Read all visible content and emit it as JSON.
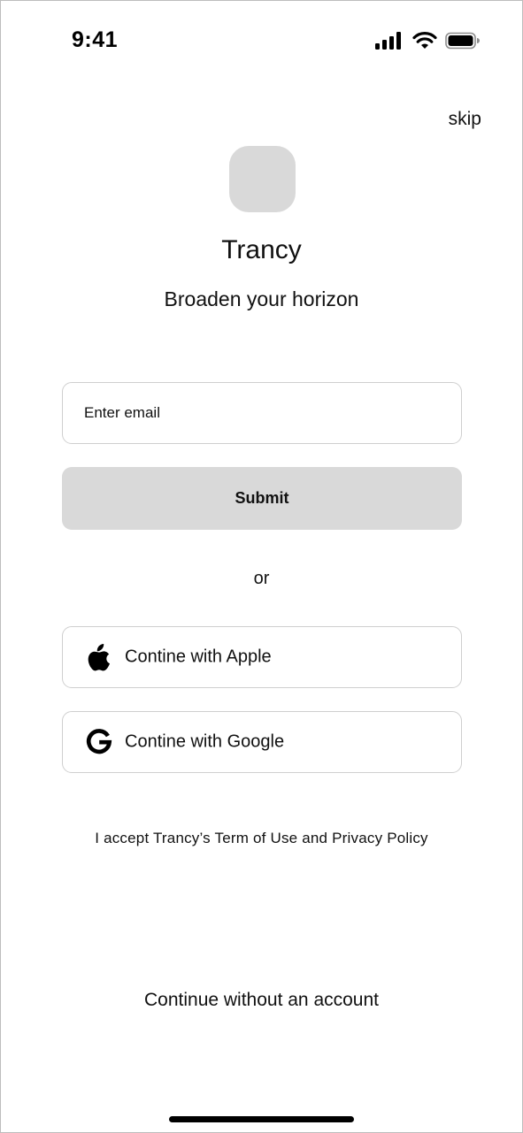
{
  "status_bar": {
    "time": "9:41"
  },
  "header": {
    "skip_label": "skip"
  },
  "app": {
    "name": "Trancy",
    "tagline": "Broaden your horizon"
  },
  "form": {
    "email_placeholder": "Enter email",
    "email_value": "",
    "submit_label": "Submit"
  },
  "divider": {
    "label": "or"
  },
  "social": {
    "apple_label": "Contine with Apple",
    "google_label": "Contine with Google"
  },
  "terms": {
    "text": "I accept Trancy’s Term of Use and Privacy Policy"
  },
  "footer": {
    "continue_label": "Continue without an account"
  },
  "colors": {
    "logo_placeholder": "#d9d9d9",
    "submit_background": "#d9d9d9",
    "border": "#cfcfcf",
    "text": "#111111"
  }
}
